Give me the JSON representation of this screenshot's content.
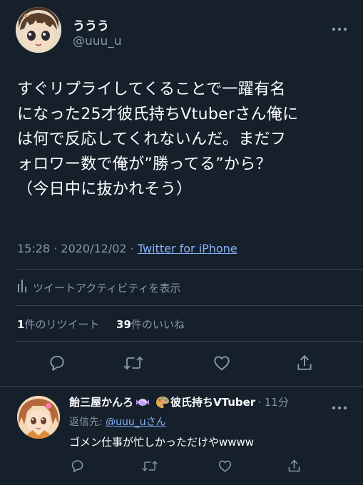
{
  "tweet": {
    "author_name": "ううう",
    "author_handle": "@uuu_u",
    "text": "すぐリプライしてくることで一躍有名\nになった25才彼氏持ちVtuberさん俺に\nは何で反応してくれないんだ。まだフ\nォロワー数で俺が”勝ってる”から？\n（今日中に抜かれそう）",
    "time": "15:28",
    "date": "2020/12/02",
    "separator": "·",
    "source": "Twitter for iPhone",
    "activity_label": "ツイートアクティビティを表示",
    "retweet_count": "1",
    "retweet_label": "件のリツイート",
    "like_count": "39",
    "like_label": "件のいいね"
  },
  "reply": {
    "author_name_part1": "飴三屋かんろ",
    "author_name_part2": "彼氏持ちVTuber",
    "time": "· 11分",
    "reply_to_label": "返信先: ",
    "reply_to_handle": "@uuu_uさん",
    "text": "ゴメン仕事が忙しかっただけやwwww"
  },
  "icons": {
    "more": "more-dots-icon",
    "activity": "bar-chart-icon",
    "reply": "reply-bubble-icon",
    "retweet": "retweet-icon",
    "like": "heart-icon",
    "share": "share-icon",
    "candy": "candy-emoji",
    "palette": "palette-emoji"
  },
  "colors": {
    "background": "#15202b",
    "text_primary": "#ffffff",
    "text_secondary": "#8899a6",
    "link": "#8ab4f8",
    "divider": "#38444d"
  }
}
